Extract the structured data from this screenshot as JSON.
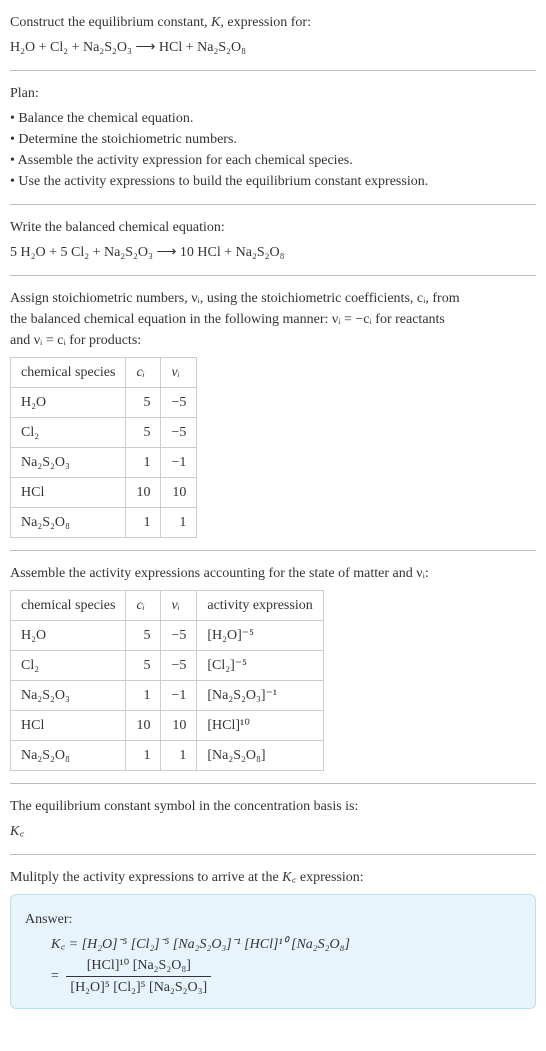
{
  "prompt_lines": [
    "Construct the equilibrium constant, K, expression for:"
  ],
  "equation_unbalanced": "H₂O + Cl₂ + Na₂S₂O₃  ⟶  HCl + Na₂S₂O₈",
  "plan_header": "Plan:",
  "plan_bullets": [
    "• Balance the chemical equation.",
    "• Determine the stoichiometric numbers.",
    "• Assemble the activity expression for each chemical species.",
    "• Use the activity expressions to build the equilibrium constant expression."
  ],
  "balanced_prompt": "Write the balanced chemical equation:",
  "equation_balanced": "5 H₂O + 5 Cl₂ + Na₂S₂O₃  ⟶  10 HCl + Na₂S₂O₈",
  "assign_text_lines": [
    "Assign stoichiometric numbers, νᵢ, using the stoichiometric coefficients, cᵢ, from",
    "the balanced chemical equation in the following manner: νᵢ = −cᵢ for reactants",
    "and νᵢ = cᵢ for products:"
  ],
  "table1": {
    "headers": [
      "chemical species",
      "cᵢ",
      "νᵢ"
    ],
    "rows": [
      [
        "H₂O",
        "5",
        "−5"
      ],
      [
        "Cl₂",
        "5",
        "−5"
      ],
      [
        "Na₂S₂O₃",
        "1",
        "−1"
      ],
      [
        "HCl",
        "10",
        "10"
      ],
      [
        "Na₂S₂O₈",
        "1",
        "1"
      ]
    ]
  },
  "assemble_text": "Assemble the activity expressions accounting for the state of matter and νᵢ:",
  "table2": {
    "headers": [
      "chemical species",
      "cᵢ",
      "νᵢ",
      "activity expression"
    ],
    "rows": [
      [
        "H₂O",
        "5",
        "−5",
        "[H₂O]⁻⁵"
      ],
      [
        "Cl₂",
        "5",
        "−5",
        "[Cl₂]⁻⁵"
      ],
      [
        "Na₂S₂O₃",
        "1",
        "−1",
        "[Na₂S₂O₃]⁻¹"
      ],
      [
        "HCl",
        "10",
        "10",
        "[HCl]¹⁰"
      ],
      [
        "Na₂S₂O₈",
        "1",
        "1",
        "[Na₂S₂O₈]"
      ]
    ]
  },
  "symbol_text": "The equilibrium constant symbol in the concentration basis is:",
  "symbol": "K꜀",
  "multiply_text": "Mulitply the activity expressions to arrive at the K꜀ expression:",
  "answer_label": "Answer:",
  "answer_line1": "K꜀ = [H₂O]⁻⁵ [Cl₂]⁻⁵ [Na₂S₂O₃]⁻¹ [HCl]¹⁰ [Na₂S₂O₈]",
  "answer_frac_num": "[HCl]¹⁰ [Na₂S₂O₈]",
  "answer_frac_den": "[H₂O]⁵ [Cl₂]⁵ [Na₂S₂O₃]",
  "answer_eq_prefix": "= "
}
